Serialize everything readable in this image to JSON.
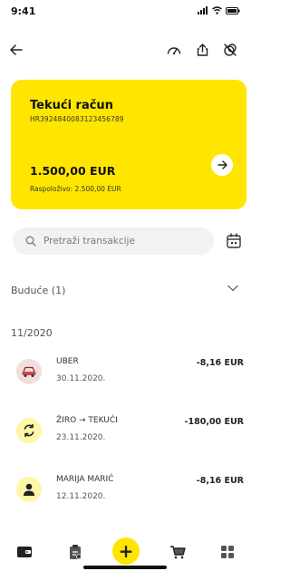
{
  "status_bar": {
    "time": "9:41"
  },
  "header": {
    "back_icon": "arrow-left-icon",
    "actions": [
      "speedometer-icon",
      "share-icon",
      "no-money-icon"
    ]
  },
  "account": {
    "title": "Tekući račun",
    "iban": "HR3924840083123456789",
    "balance": "1.500,00 EUR",
    "available": "Raspoloživo: 2.500,00 EUR",
    "card_color": "#ffe600"
  },
  "search": {
    "placeholder": "Pretraži transakcije"
  },
  "future": {
    "label": "Buduće (1)"
  },
  "month": "11/2020",
  "transactions": [
    {
      "name": "UBER",
      "date": "30.11.2020.",
      "amount": "-8,16 EUR",
      "icon": "car-icon"
    },
    {
      "name": "ŽIRO → TEKUĆI",
      "date": "23.11.2020.",
      "amount": "-180,00 EUR",
      "icon": "transfer-icon"
    },
    {
      "name": "MARIJA MARIĆ",
      "date": "12.11.2020.",
      "amount": "-8,16 EUR",
      "icon": "person-icon"
    }
  ],
  "bottom_nav": {
    "items": [
      "wallet-icon",
      "clipboard-icon",
      "add-icon",
      "cart-icon",
      "grid-icon"
    ],
    "add_symbol": "+"
  }
}
